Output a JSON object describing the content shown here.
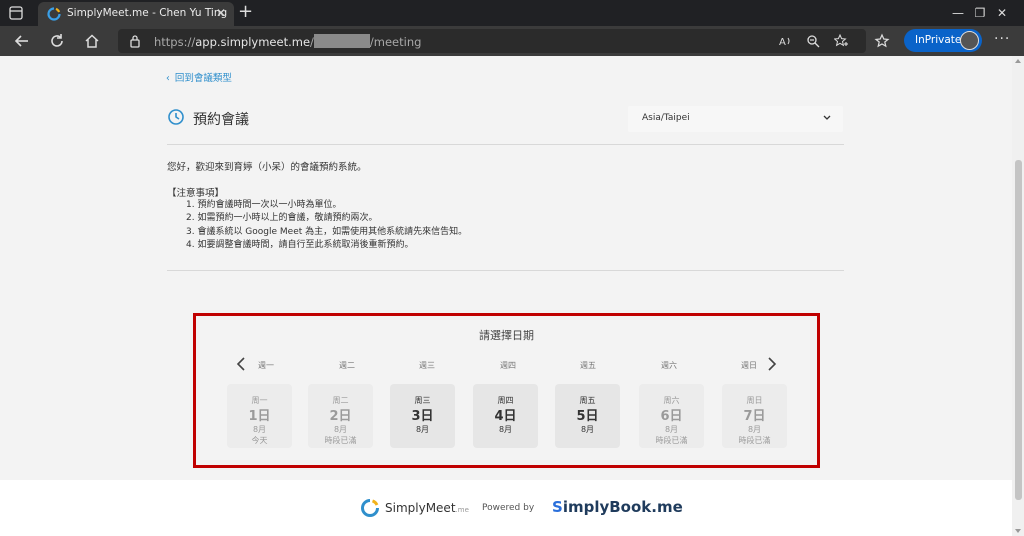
{
  "browser": {
    "tab_title": "SimplyMeet.me - Chen Yu Ting",
    "url_scheme": "https://",
    "url_host": "app.simplymeet.me",
    "url_sep": "/",
    "url_path": "/meeting",
    "inprivate_label": "InPrivate"
  },
  "page": {
    "back_link": "回到會議類型",
    "heading": "預約會議",
    "timezone": "Asia/Taipei",
    "intro": "您好，歡迎來到育婷（小呆）的會議預約系統。",
    "notes_title": "【注意事項】",
    "notes": [
      "1. 預約會議時間一次以一小時為單位。",
      "2. 如需預約一小時以上的會議，敬請預約兩次。",
      "3. 會議系統以 Google Meet 為主，如需使用其他系統請先來信告知。",
      "4. 如要調整會議時間，請自行至此系統取消後重新預約。"
    ]
  },
  "calendar": {
    "title": "請選擇日期",
    "weekday_headers": [
      "週一",
      "週二",
      "週三",
      "週四",
      "週五",
      "週六",
      "週日"
    ],
    "days": [
      {
        "weekday": "周一",
        "date": "1日",
        "month": "8月",
        "note": "今天",
        "state": "disabled"
      },
      {
        "weekday": "周二",
        "date": "2日",
        "month": "8月",
        "note": "時段已滿",
        "state": "disabled"
      },
      {
        "weekday": "周三",
        "date": "3日",
        "month": "8月",
        "note": "",
        "state": "available"
      },
      {
        "weekday": "周四",
        "date": "4日",
        "month": "8月",
        "note": "",
        "state": "available"
      },
      {
        "weekday": "周五",
        "date": "5日",
        "month": "8月",
        "note": "",
        "state": "available"
      },
      {
        "weekday": "周六",
        "date": "6日",
        "month": "8月",
        "note": "時段已滿",
        "state": "disabled"
      },
      {
        "weekday": "周日",
        "date": "7日",
        "month": "8月",
        "note": "時段已滿",
        "state": "disabled"
      }
    ]
  },
  "footer": {
    "brand_name": "SimplyMeet",
    "brand_suffix": ".me",
    "powered_by": "Powered by",
    "simplybook_s": "S",
    "simplybook_rest": "implyBook.me"
  },
  "colors": {
    "accent": "#2f8fcc",
    "highlight_frame": "#c00000",
    "inprivate": "#0a63c9"
  }
}
